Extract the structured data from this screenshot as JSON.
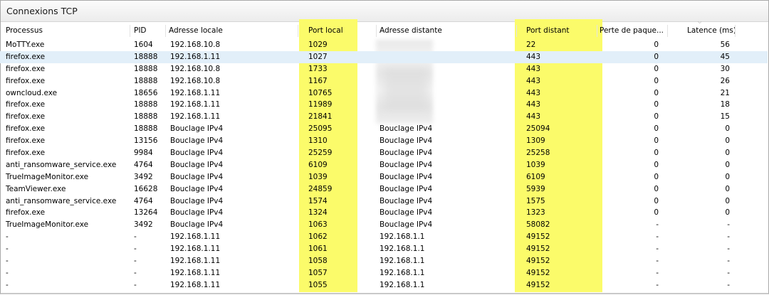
{
  "window": {
    "title": "Connexions TCP"
  },
  "columns": [
    {
      "key": "process",
      "label": "Processus"
    },
    {
      "key": "pid",
      "label": "PID"
    },
    {
      "key": "local_addr",
      "label": "Adresse locale"
    },
    {
      "key": "local_port",
      "label": "Port local"
    },
    {
      "key": "remote_addr",
      "label": "Adresse distante"
    },
    {
      "key": "remote_port",
      "label": "Port distant"
    },
    {
      "key": "packet_loss",
      "label": "Perte de paque..."
    },
    {
      "key": "latency",
      "label": "Latence (ms)"
    }
  ],
  "sort_indicator": "⌵",
  "highlight_color": "#fbfb6a",
  "selected_row_color": "#e2eff9",
  "rows": [
    [
      "MoTTY.exe",
      "1604",
      "192.168.10.8",
      "1029",
      "",
      "22",
      "0",
      "56"
    ],
    [
      "firefox.exe",
      "18888",
      "192.168.1.11",
      "1027",
      "",
      "443",
      "0",
      "45"
    ],
    [
      "firefox.exe",
      "18888",
      "192.168.10.8",
      "1733",
      "",
      "443",
      "0",
      "30"
    ],
    [
      "firefox.exe",
      "18888",
      "192.168.10.8",
      "1167",
      "",
      "443",
      "0",
      "26"
    ],
    [
      "owncloud.exe",
      "18656",
      "192.168.1.11",
      "10765",
      "",
      "443",
      "0",
      "21"
    ],
    [
      "firefox.exe",
      "18888",
      "192.168.1.11",
      "11989",
      "",
      "443",
      "0",
      "18"
    ],
    [
      "firefox.exe",
      "18888",
      "192.168.1.11",
      "21841",
      "",
      "443",
      "0",
      "15"
    ],
    [
      "firefox.exe",
      "18888",
      "Bouclage IPv4",
      "25095",
      "Bouclage IPv4",
      "25094",
      "0",
      "0"
    ],
    [
      "firefox.exe",
      "13156",
      "Bouclage IPv4",
      "1310",
      "Bouclage IPv4",
      "1309",
      "0",
      "0"
    ],
    [
      "firefox.exe",
      "9984",
      "Bouclage IPv4",
      "25259",
      "Bouclage IPv4",
      "25258",
      "0",
      "0"
    ],
    [
      "anti_ransomware_service.exe",
      "4764",
      "Bouclage IPv4",
      "6109",
      "Bouclage IPv4",
      "1039",
      "0",
      "0"
    ],
    [
      "TrueImageMonitor.exe",
      "3492",
      "Bouclage IPv4",
      "1039",
      "Bouclage IPv4",
      "6109",
      "0",
      "0"
    ],
    [
      "TeamViewer.exe",
      "16628",
      "Bouclage IPv4",
      "24859",
      "Bouclage IPv4",
      "5939",
      "0",
      "0"
    ],
    [
      "anti_ransomware_service.exe",
      "4764",
      "Bouclage IPv4",
      "1574",
      "Bouclage IPv4",
      "1575",
      "0",
      "0"
    ],
    [
      "firefox.exe",
      "13264",
      "Bouclage IPv4",
      "1324",
      "Bouclage IPv4",
      "1323",
      "0",
      "0"
    ],
    [
      "TrueImageMonitor.exe",
      "3492",
      "Bouclage IPv4",
      "1063",
      "Bouclage IPv4",
      "58082",
      "-",
      "-"
    ],
    [
      "-",
      "-",
      "192.168.1.11",
      "1062",
      "192.168.1.1",
      "49152",
      "-",
      "-"
    ],
    [
      "-",
      "-",
      "192.168.1.11",
      "1061",
      "192.168.1.1",
      "49152",
      "-",
      "-"
    ],
    [
      "-",
      "-",
      "192.168.1.11",
      "1058",
      "192.168.1.1",
      "49152",
      "-",
      "-"
    ],
    [
      "-",
      "-",
      "192.168.1.11",
      "1057",
      "192.168.1.1",
      "49152",
      "-",
      "-"
    ],
    [
      "-",
      "-",
      "192.168.1.11",
      "1055",
      "192.168.1.1",
      "49152",
      "-",
      "-"
    ]
  ],
  "selected_row_index": 1
}
